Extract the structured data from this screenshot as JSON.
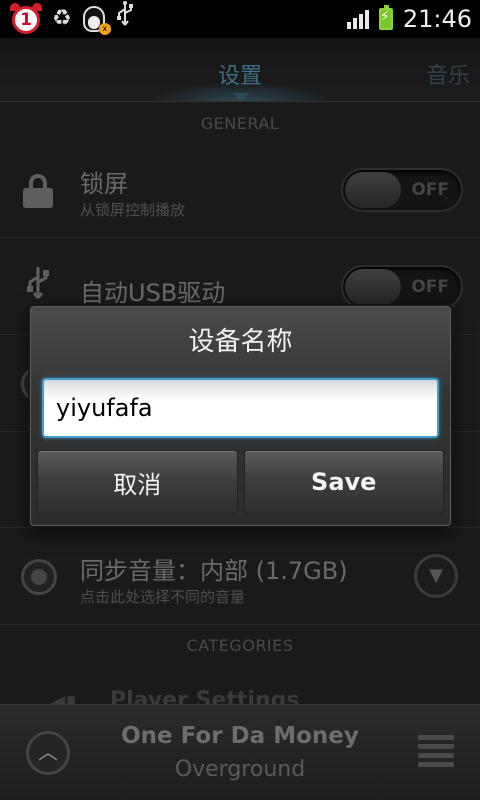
{
  "status_bar": {
    "alarm_badge": "1",
    "time": "21:46",
    "icons": [
      "alarm-clock-icon",
      "recycle-icon",
      "qq-penguin-icon",
      "usb-icon",
      "signal-icon",
      "battery-charging-icon"
    ]
  },
  "tabs": {
    "active": "设置",
    "next": "音乐"
  },
  "sections": {
    "general": "GENERAL",
    "categories": "CATEGORIES"
  },
  "settings": {
    "lock_screen": {
      "title": "锁屏",
      "subtitle": "从锁屏控制播放",
      "toggle": "OFF"
    },
    "auto_usb": {
      "title": "自动USB驱动",
      "toggle": "OFF"
    },
    "sync_volume": {
      "title": "同步音量：内部 (1.7GB)",
      "subtitle": "点击此处选择不同的音量"
    },
    "player_settings": {
      "title": "Player Settings"
    }
  },
  "dialog": {
    "title": "设备名称",
    "input_value": "yiyufafa",
    "cancel_label": "取消",
    "save_label": "Save"
  },
  "now_playing": {
    "title": "One For Da Money",
    "artist": "Overground"
  },
  "colors": {
    "accent_blue": "#3f9fcf",
    "battery_green": "#7cc52b",
    "alarm_red": "#d4202a"
  }
}
